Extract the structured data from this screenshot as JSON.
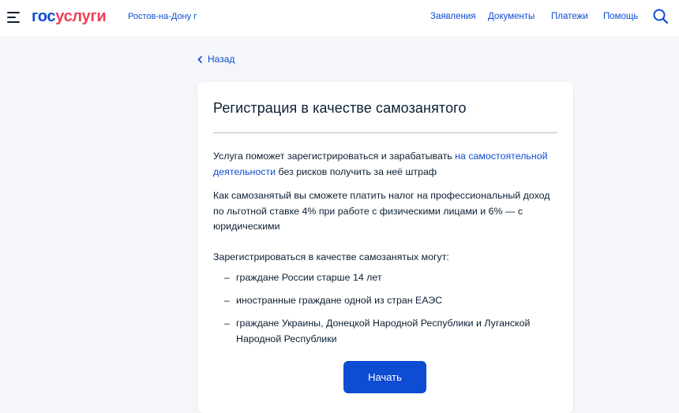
{
  "header": {
    "logo_part1": "гос",
    "logo_part2": "услуги",
    "city": "Ростов-на-Дону г",
    "nav": [
      "Заявления",
      "Документы",
      "Платежи",
      "Помощь"
    ]
  },
  "back_label": "Назад",
  "card": {
    "title": "Регистрация в качестве самозанятого",
    "p1": {
      "before": "Услуга поможет зарегистрироваться и зарабатывать ",
      "link": "на самостоятельной деятельности",
      "after": " без рисков получить за неё штраф"
    },
    "p2": "Как самозанятый вы сможете платить налог на профессиональный доход по льготной ставке 4% при работе с физическими лицами и 6% — с юридическими",
    "p3": "Зарегистрироваться в качестве самозанятых могут:",
    "list_dash": "–",
    "list": [
      "граждане России старше 14 лет",
      "иностранные граждане одной из стран ЕАЭС",
      "граждане Украины, Донецкой Народной Республики и Луганской Народной Республики"
    ],
    "start_label": "Начать"
  },
  "colors": {
    "brand_blue": "#0d4cd3",
    "brand_red": "#ee3f58",
    "text": "#0b1f33",
    "background": "#f4f6fa"
  },
  "icons": {
    "menu": "menu-icon",
    "search": "search-icon",
    "back": "chevron-left-icon"
  }
}
